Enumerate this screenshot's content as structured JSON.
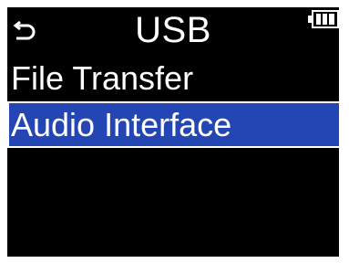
{
  "header": {
    "back_icon": "back-arrow-icon",
    "title": "USB",
    "battery_icon": "battery-icon"
  },
  "menu": {
    "items": [
      {
        "label": "File Transfer",
        "selected": false
      },
      {
        "label": "Audio Interface",
        "selected": true
      }
    ]
  },
  "colors": {
    "background": "#000000",
    "text": "#ffffff",
    "selection": "#2446b4"
  }
}
